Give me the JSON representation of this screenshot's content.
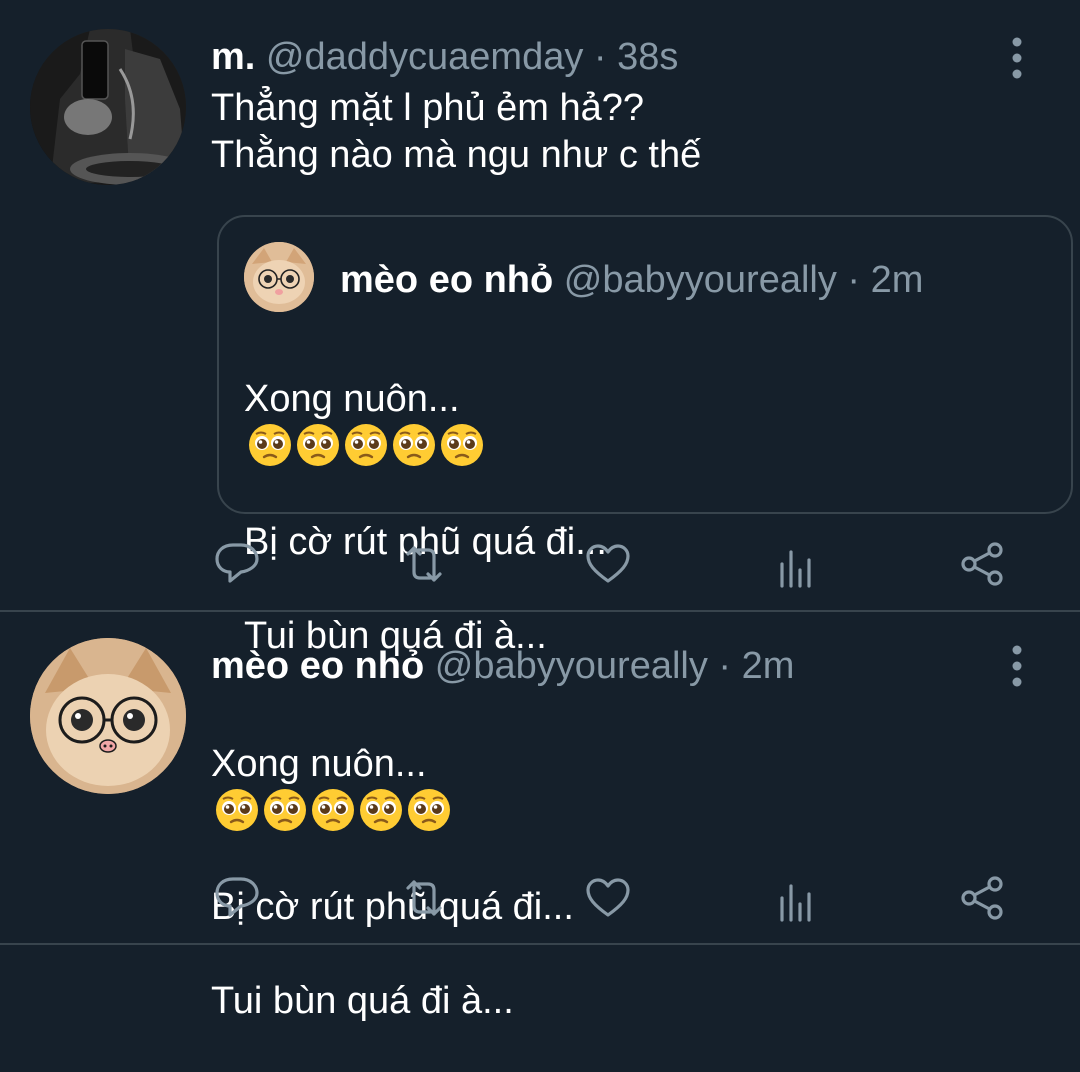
{
  "tweets": [
    {
      "name": "m.",
      "handle": "@daddycuaemday",
      "separator": "·",
      "time": "38s",
      "text": "Thẳng mặt l phủ ẻm hả??\nThằng nào mà ngu như c thế",
      "quoted": {
        "name": "mèo eo nhỏ",
        "handle": "@babyyoureally",
        "separator": "·",
        "time": "2m",
        "line1": "Xong nuôn...",
        "line1_emoji": [
          "pleading-face",
          "pleading-face",
          "pleading-face",
          "pleading-face",
          "pleading-face"
        ],
        "line2": "Bị cờ rút phũ quá đi...",
        "line3": "Tui bùn quá đi à..."
      },
      "actions": [
        "reply-icon",
        "retweet-icon",
        "like-icon",
        "analytics-icon",
        "share-icon"
      ]
    },
    {
      "name": "mèo eo nhỏ",
      "handle": "@babyyoureally",
      "separator": "·",
      "time": "2m",
      "line1": "Xong nuôn...",
      "line1_emoji": [
        "pleading-face",
        "pleading-face",
        "pleading-face",
        "pleading-face",
        "pleading-face"
      ],
      "line2": "Bị cờ rút phũ quá đi...",
      "line3": "Tui bùn quá đi à...",
      "actions": [
        "reply-icon",
        "retweet-icon",
        "like-icon",
        "analytics-icon",
        "share-icon"
      ]
    }
  ],
  "colors": {
    "background": "#15202b",
    "divider": "#38444d",
    "secondary_text": "#8899a6",
    "primary_text": "#ffffff"
  }
}
